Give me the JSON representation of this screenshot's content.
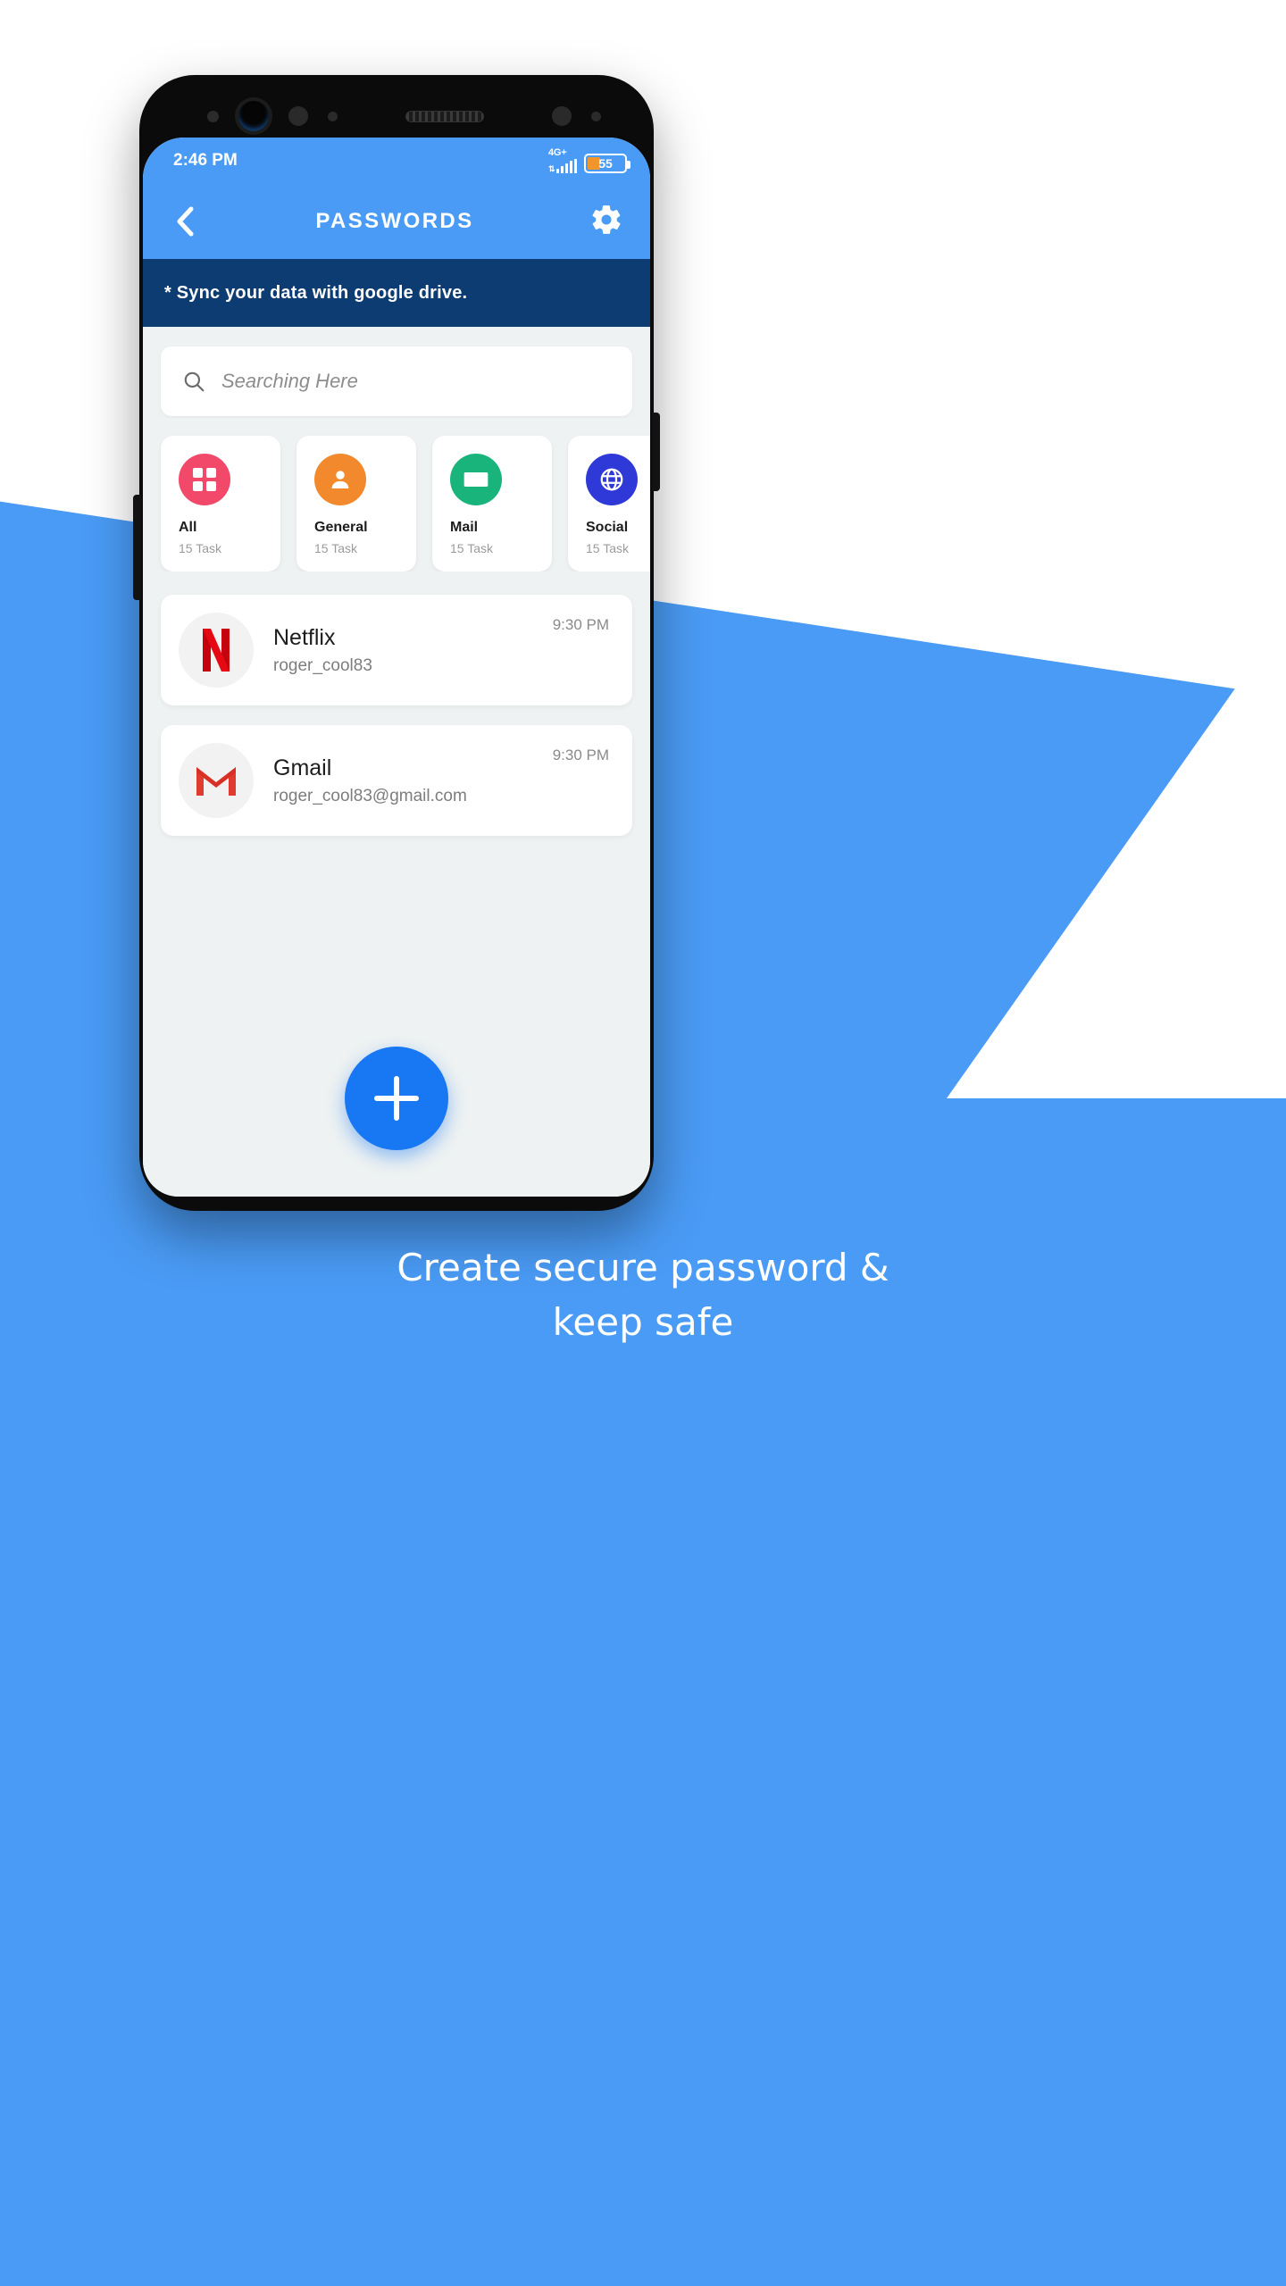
{
  "status_bar": {
    "time": "2:46 PM",
    "network_label": "4G+",
    "battery_percent": "55",
    "signal_icon": "signal-bars-icon",
    "battery_icon": "battery-icon"
  },
  "app_bar": {
    "back_icon": "chevron-left-icon",
    "title": "PASSWORDS",
    "settings_icon": "gear-icon"
  },
  "sync_banner": {
    "text": "* Sync your data with google drive."
  },
  "search": {
    "placeholder": "Searching Here",
    "icon": "search-icon"
  },
  "categories": [
    {
      "name": "All",
      "count": "15 Task",
      "color": "#f2496b",
      "icon": "grid-icon"
    },
    {
      "name": "General",
      "count": "15 Task",
      "color": "#f2892c",
      "icon": "person-icon"
    },
    {
      "name": "Mail",
      "count": "15 Task",
      "color": "#18b47c",
      "icon": "envelope-icon"
    },
    {
      "name": "Social",
      "count": "15 Task",
      "color": "#2f39d8",
      "icon": "globe-icon"
    }
  ],
  "passwords": [
    {
      "title": "Netflix",
      "username": "roger_cool83",
      "time": "9:30 PM",
      "logo": "netflix-logo"
    },
    {
      "title": "Gmail",
      "username": "roger_cool83@gmail.com",
      "time": "9:30 PM",
      "logo": "gmail-logo"
    }
  ],
  "fab": {
    "icon": "plus-icon"
  },
  "promo": {
    "line1": "Create secure password &",
    "line2": "keep safe"
  },
  "colors": {
    "accent": "#4a9bf5",
    "banner": "#0d3c73",
    "fab": "#1877f2",
    "screen_bg": "#eef2f2"
  }
}
